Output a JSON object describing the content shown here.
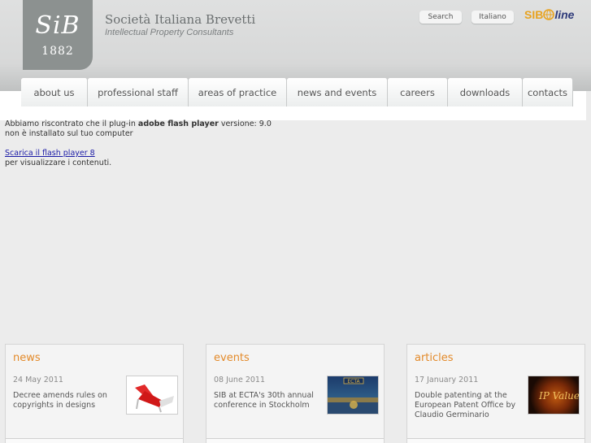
{
  "header": {
    "logo_mark": "SiB",
    "logo_year": "1882",
    "company_name": "Società Italiana Brevetti",
    "company_tagline": "Intellectual Property Consultants",
    "search_label": "Search",
    "language_label": "Italiano",
    "sibonline_sib": "SIB",
    "sibonline_line": "line"
  },
  "nav": {
    "items": [
      {
        "label": "about us"
      },
      {
        "label": "professional staff"
      },
      {
        "label": "areas of practice"
      },
      {
        "label": "news and events"
      },
      {
        "label": "careers"
      },
      {
        "label": "downloads"
      },
      {
        "label": "contacts"
      }
    ]
  },
  "flash": {
    "line1_prefix": "Abbiamo riscontrato che il plug-in ",
    "line1_bold": "adobe flash player",
    "line1_suffix": " versione: 9.0",
    "line2": "non è installato sul tuo computer",
    "link": "Scarica il flash player 8",
    "after": "per visualizzare i contenuti."
  },
  "boxes": {
    "news": {
      "title": "news",
      "date": "24 May 2011",
      "text": "Decree amends rules on copyrights in designs",
      "thumb_icon": "chair-design-image"
    },
    "events": {
      "title": "events",
      "date": "08 June 2011",
      "text": "SIB at ECTA's 30th annual conference in Stockholm",
      "thumb_label": "ECTA",
      "thumb_icon": "stockholm-harbor-image"
    },
    "articles": {
      "title": "articles",
      "date": "17 January 2011",
      "text": "Double patenting at the European Patent Office by Claudio Germinario",
      "thumb_label": "IP Value",
      "thumb_icon": "ip-value-cover-image"
    }
  },
  "colors": {
    "accent": "#e38a2a",
    "logo_bg": "#8c9190",
    "link": "#1a1aa6"
  }
}
